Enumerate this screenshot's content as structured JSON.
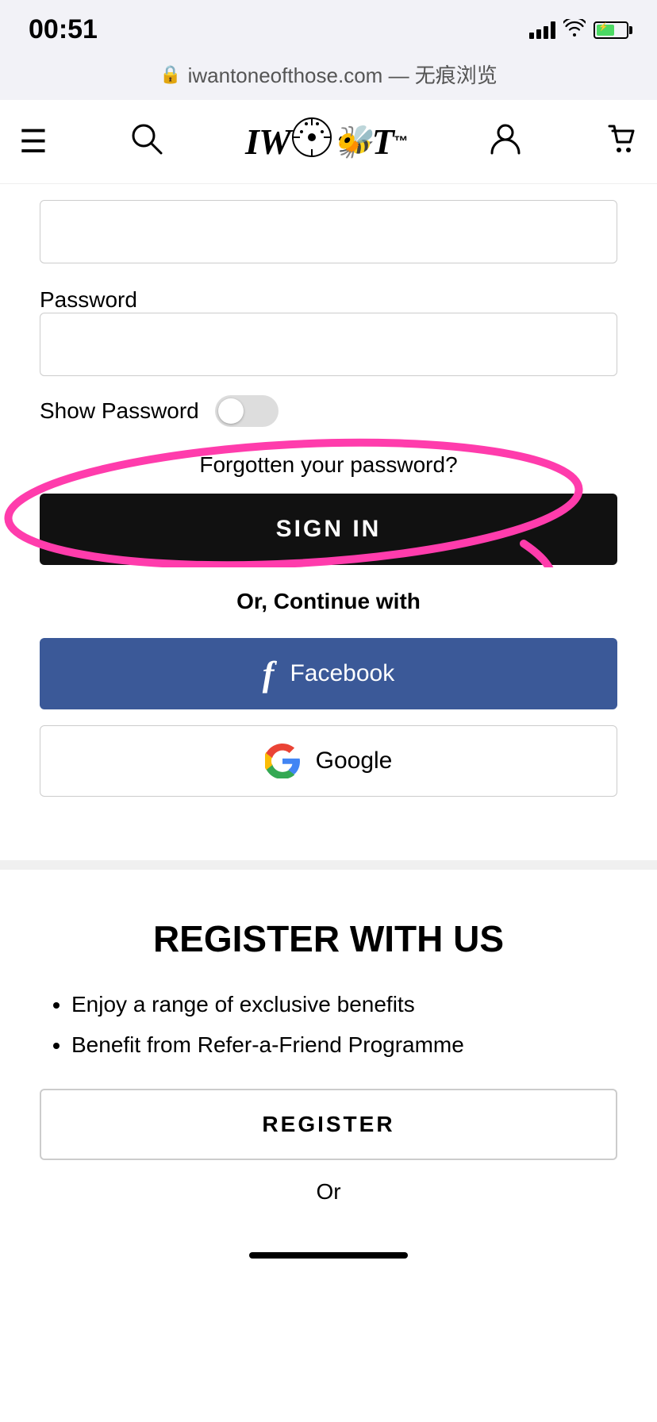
{
  "statusBar": {
    "time": "00:51",
    "url": "iwantoneofthose.com",
    "urlSuffix": "— 无痕浏览"
  },
  "nav": {
    "logoText": "IWOOT",
    "menuLabel": "≡",
    "searchLabel": "🔍",
    "userLabel": "👤",
    "cartLabel": "🛒"
  },
  "form": {
    "passwordLabel": "Password",
    "passwordPlaceholder": "",
    "showPasswordLabel": "Show Password",
    "forgottenLink": "Forgotten your password?",
    "signInLabel": "SIGN IN",
    "orContinueLabel": "Or, Continue with",
    "facebookLabel": "Facebook",
    "googleLabel": "Google"
  },
  "register": {
    "title": "REGISTER WITH US",
    "benefits": [
      "Enjoy a range of exclusive benefits",
      "Benefit from Refer-a-Friend Programme"
    ],
    "registerBtn": "REGISTER",
    "orLabel": "Or"
  }
}
